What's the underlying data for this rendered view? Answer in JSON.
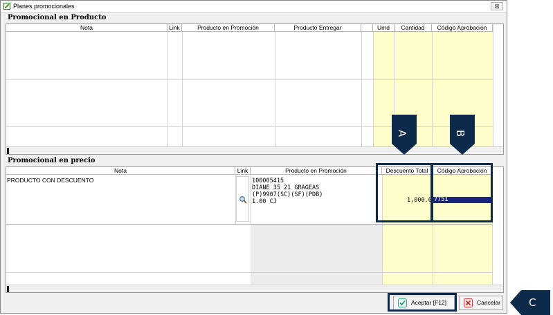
{
  "window": {
    "title": "Planes promocionales",
    "close_label": "⊠"
  },
  "product_section": {
    "title": "Promocional en Producto",
    "columns": [
      "Nota",
      "Link",
      "Producto en Promoción",
      "Producto Entregar",
      "Umd",
      "Cantidad",
      "Código Aprobación"
    ]
  },
  "price_section": {
    "title": "Promocional en precio",
    "columns": [
      "Nota",
      "Link",
      "Producto en Promoción",
      "Descuento Total",
      "Código Aprobación"
    ],
    "row": {
      "nota": "PRODUCTO CON DESCUENTO",
      "product_lines": [
        "100005415",
        "DIANE 35 21 GRAGEAS",
        "(P)9907(SC)(SF)(PDB)",
        "1.00 CJ"
      ],
      "descuento": "1,000.00",
      "codigo": "7751"
    }
  },
  "callouts": {
    "a": "A",
    "b": "B",
    "c": "C"
  },
  "buttons": {
    "accept": "Aceptar [F12]",
    "cancel": "Cancelar"
  },
  "icons": {
    "search": "magnifier-icon",
    "check": "check-icon",
    "cancel": "cancel-x-icon"
  }
}
